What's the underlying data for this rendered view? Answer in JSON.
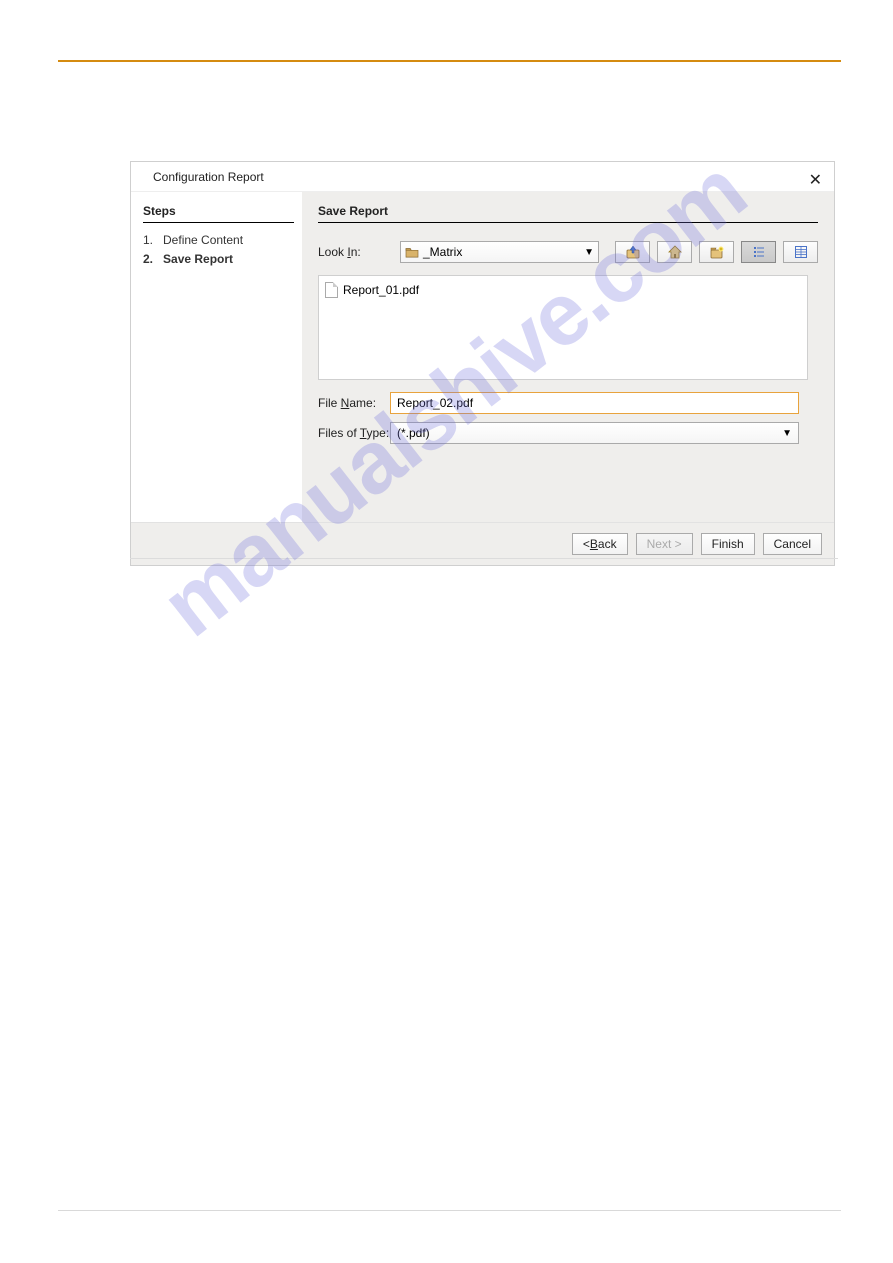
{
  "dialog": {
    "title": "Configuration Report",
    "steps_heading": "Steps",
    "steps": [
      {
        "num": "1.",
        "label": "Define Content",
        "active": false
      },
      {
        "num": "2.",
        "label": "Save Report",
        "active": true
      }
    ],
    "right_title": "Save Report",
    "look_in_label_pre": "Look ",
    "look_in_label_u": "I",
    "look_in_label_post": "n:",
    "look_in_value": "_Matrix",
    "file_list": [
      "Report_01.pdf"
    ],
    "file_name_label_pre": "File ",
    "file_name_label_u": "N",
    "file_name_label_post": "ame:",
    "file_name_value": "Report_02.pdf",
    "files_of_type_label_pre": "Files of ",
    "files_of_type_label_u": "T",
    "files_of_type_label_post": "ype:",
    "files_of_type_value": "(*.pdf)",
    "buttons": {
      "back_pre": "< ",
      "back_u": "B",
      "back_post": "ack",
      "next": "Next >",
      "finish": "Finish",
      "cancel": "Cancel"
    }
  },
  "watermark": "manualshive.com"
}
